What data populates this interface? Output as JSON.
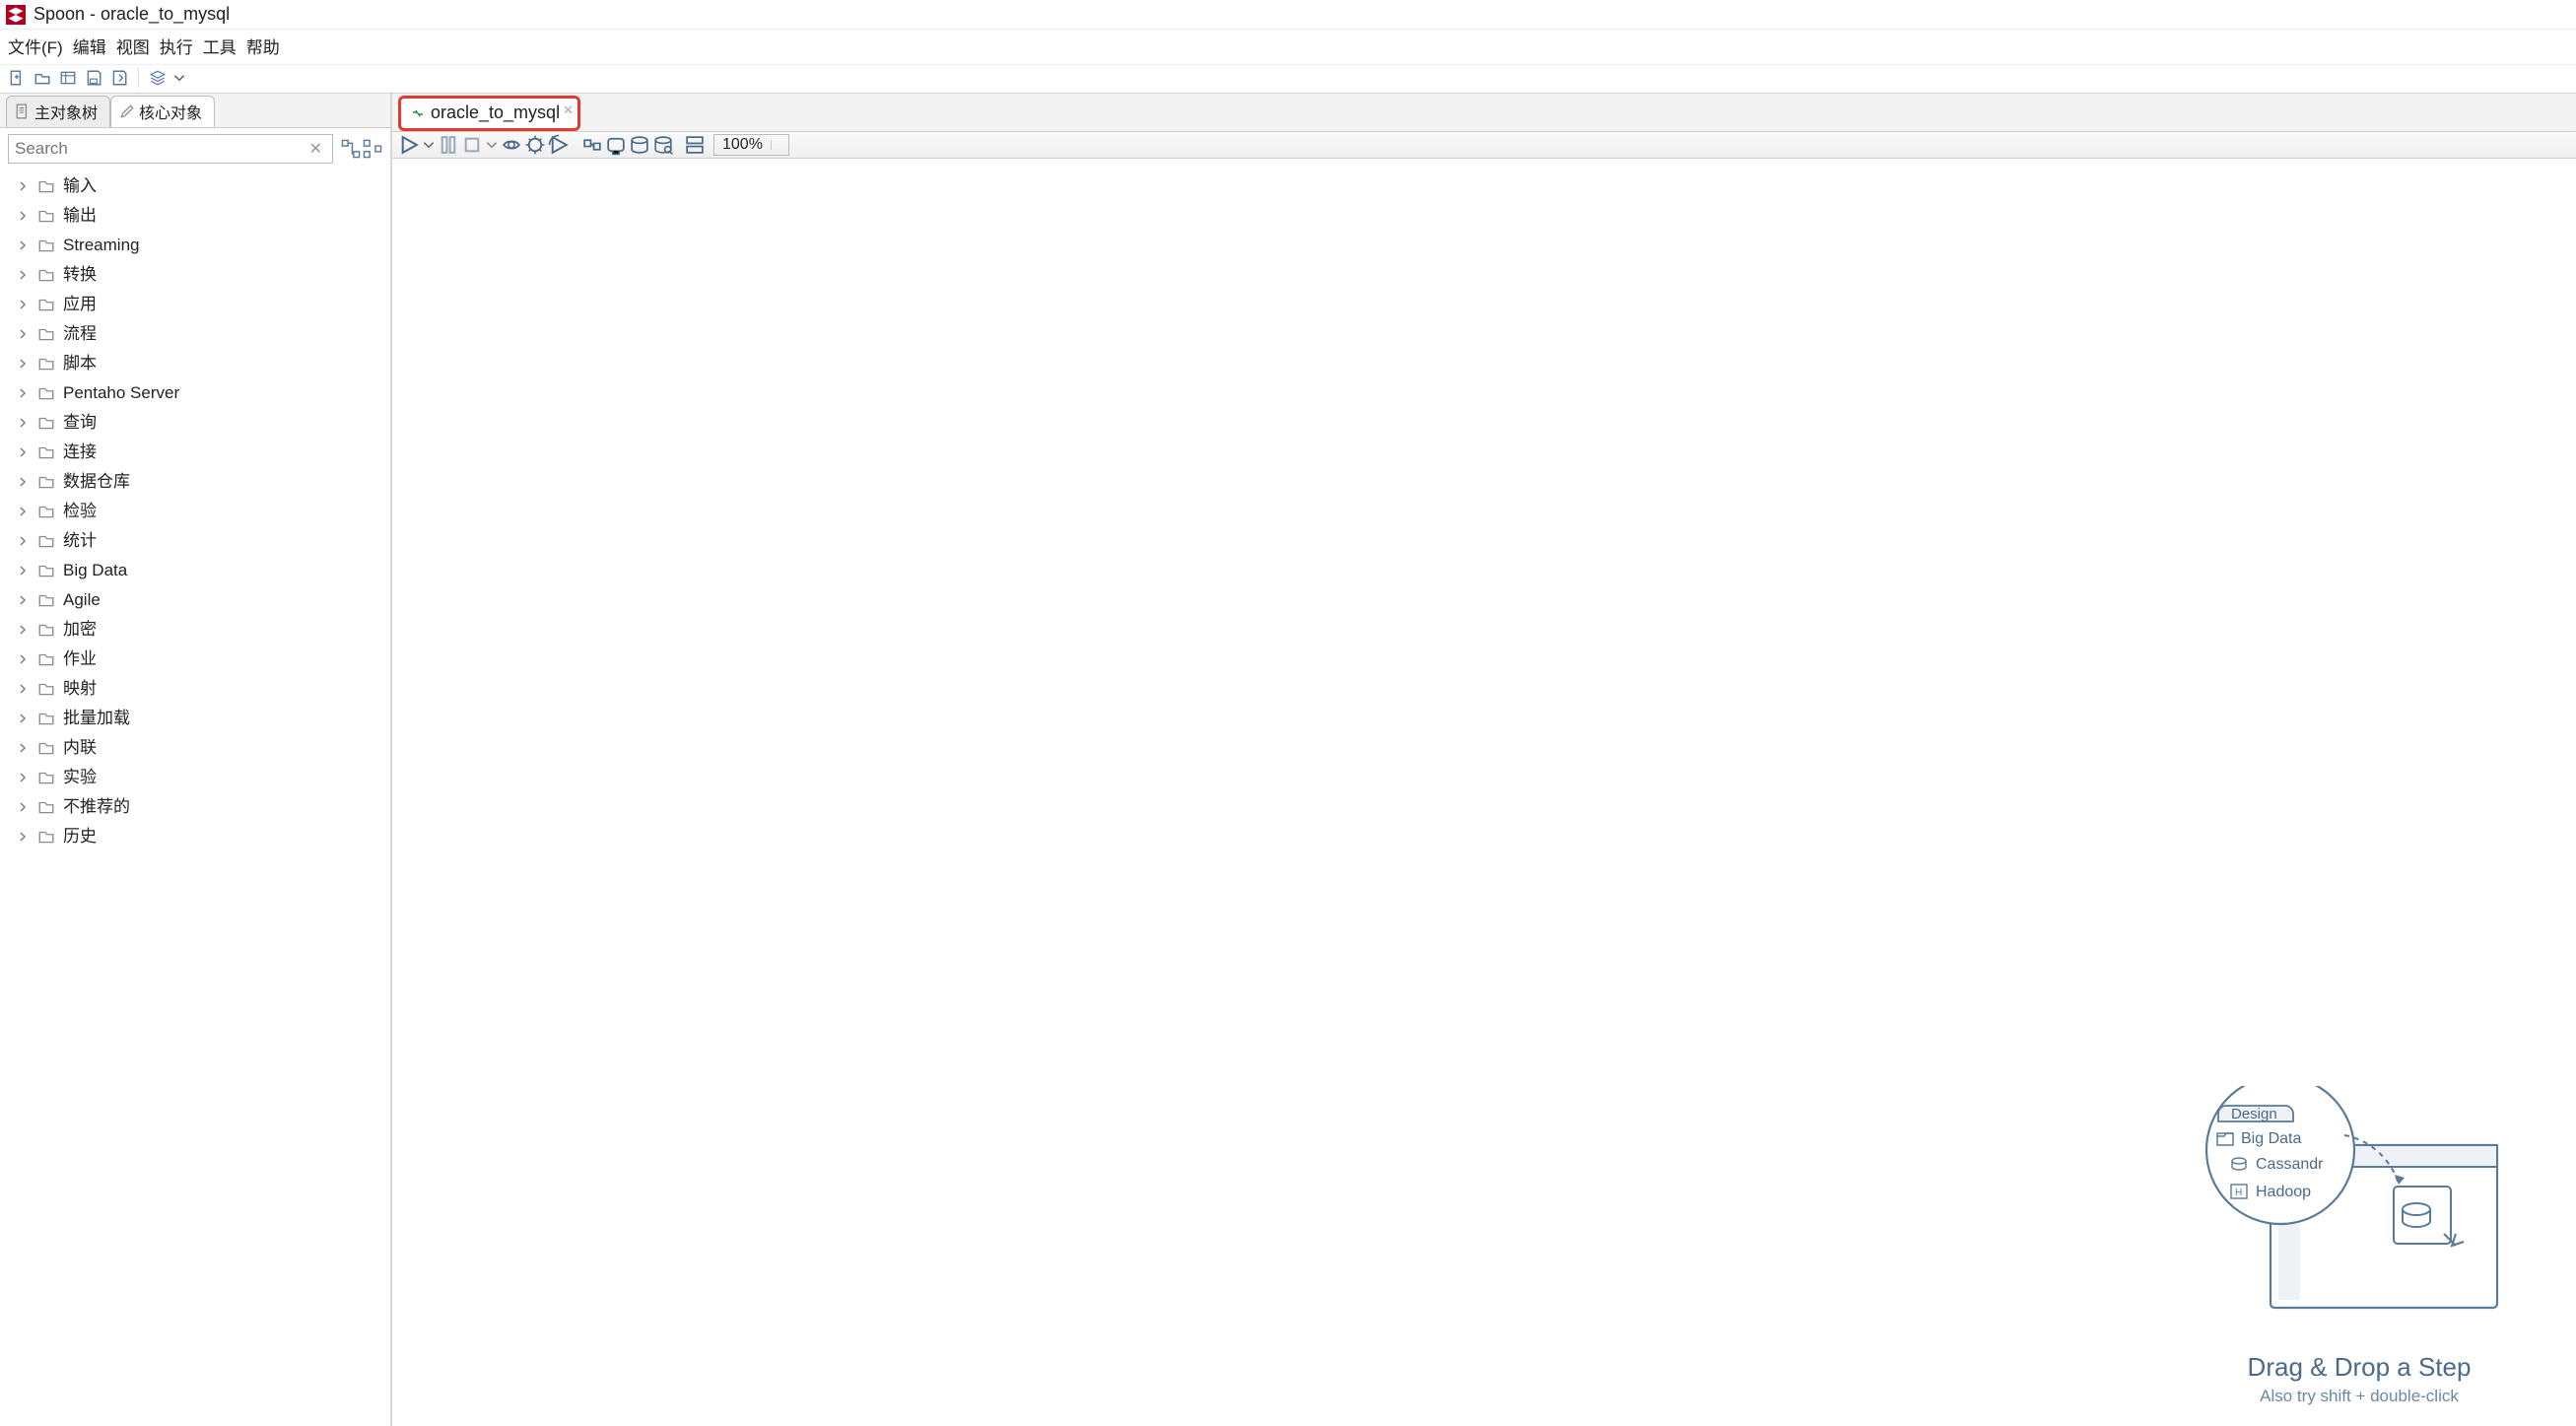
{
  "window": {
    "title": "Spoon - oracle_to_mysql"
  },
  "menu": {
    "file": "文件(F)",
    "edit": "编辑",
    "view": "视图",
    "run": "执行",
    "tools": "工具",
    "help": "帮助"
  },
  "left_tabs": {
    "main_tree": "主对象树",
    "core_objects": "核心对象"
  },
  "search": {
    "placeholder": "Search"
  },
  "tree_items": [
    "输入",
    "输出",
    "Streaming",
    "转换",
    "应用",
    "流程",
    "脚本",
    "Pentaho Server",
    "查询",
    "连接",
    "数据仓库",
    "检验",
    "统计",
    "Big Data",
    "Agile",
    "加密",
    "作业",
    "映射",
    "批量加载",
    "内联",
    "实验",
    "不推荐的",
    "历史"
  ],
  "doc_tab": {
    "label": "oracle_to_mysql"
  },
  "zoom": {
    "value": "100%"
  },
  "hint": {
    "design_tab": "Design",
    "folder": "Big Data",
    "item1": "Cassandr",
    "item2": "Hadoop",
    "title": "Drag & Drop a Step",
    "subtitle": "Also try shift + double-click"
  }
}
